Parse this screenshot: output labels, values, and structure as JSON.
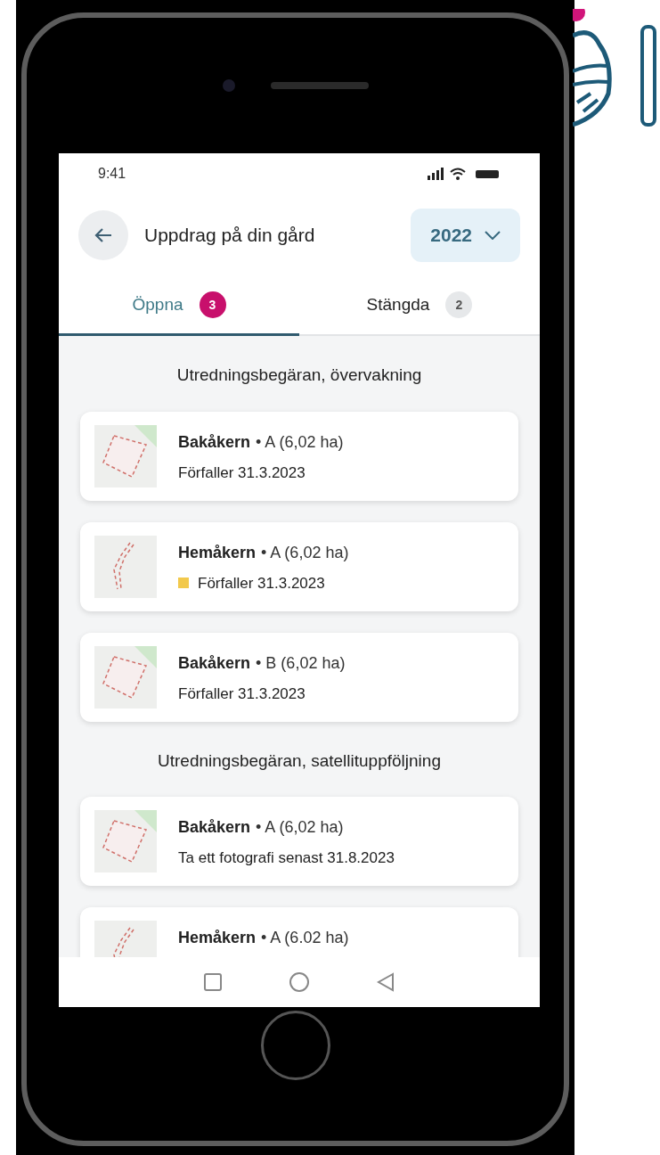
{
  "status_bar": {
    "time": "9:41"
  },
  "header": {
    "title": "Uppdrag på din gård",
    "year": "2022"
  },
  "tabs": [
    {
      "label": "Öppna",
      "count": "3",
      "selected": true
    },
    {
      "label": "Stängda",
      "count": "2",
      "selected": false
    }
  ],
  "sections": [
    {
      "title": "Utredningsbegäran, övervakning",
      "items": [
        {
          "kind": "block",
          "name": "Bakåkern",
          "plot": "• A (6,02 ha)",
          "due": "Förfaller 31.3.2023"
        },
        {
          "kind": "strip",
          "name": "Hemåkern",
          "plot": "• A (6,02 ha)",
          "due": "Förfaller 31.3.2023",
          "color": "#f2c94c"
        },
        {
          "kind": "block",
          "name": "Bakåkern",
          "plot": "• B (6,02 ha)",
          "due": "Förfaller 31.3.2023"
        }
      ]
    },
    {
      "title": "Utredningsbegäran, satellituppföljning",
      "items": [
        {
          "kind": "block",
          "name": "Bakåkern",
          "plot": "• A (6,02 ha)",
          "due": "Ta ett fotografi senast 31.8.2023"
        },
        {
          "kind": "strip",
          "name": "Hemåkern",
          "plot": "• A (6.02 ha)"
        }
      ]
    }
  ]
}
